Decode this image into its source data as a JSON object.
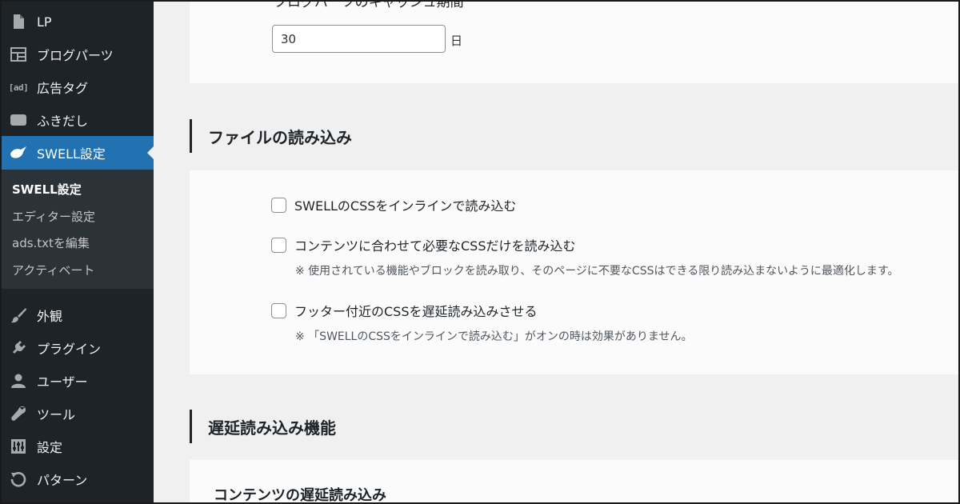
{
  "sidebar": {
    "items": [
      {
        "label": "LP",
        "icon": "page-icon"
      },
      {
        "label": "ブログパーツ",
        "icon": "layout-icon"
      },
      {
        "label": "広告タグ",
        "icon": "ad-icon",
        "icon_text": "[ad]"
      },
      {
        "label": "ふきだし",
        "icon": "speech-bubble-icon"
      },
      {
        "label": "SWELL設定",
        "icon": "swell-bird-icon",
        "active": true
      },
      {
        "label": "外観",
        "icon": "paintbrush-icon"
      },
      {
        "label": "プラグイン",
        "icon": "plug-icon"
      },
      {
        "label": "ユーザー",
        "icon": "user-icon"
      },
      {
        "label": "ツール",
        "icon": "wrench-icon"
      },
      {
        "label": "設定",
        "icon": "sliders-icon"
      },
      {
        "label": "パターン",
        "icon": "undo-icon"
      }
    ],
    "submenu": [
      {
        "label": "SWELL設定",
        "current": true
      },
      {
        "label": "エディター設定"
      },
      {
        "label": "ads.txtを編集"
      },
      {
        "label": "アクティベート"
      }
    ],
    "colors": {
      "background": "#1d2327",
      "active": "#2271b1",
      "submenu": "#2c3338"
    }
  },
  "cache": {
    "label": "ブログパーツのキャッシュ期間",
    "value": "30",
    "unit": "日"
  },
  "file_loading": {
    "title": "ファイルの読み込み",
    "options": [
      {
        "label": "SWELLのCSSをインラインで読み込む",
        "checked": false
      },
      {
        "label": "コンテンツに合わせて必要なCSSだけを読み込む",
        "checked": false,
        "note": "※ 使用されている機能やブロックを読み取り、そのページに不要なCSSはできる限り読み込まないように最適化します。"
      },
      {
        "label": "フッター付近のCSSを遅延読み込みさせる",
        "checked": false,
        "note": "※ 「SWELLのCSSをインラインで読み込む」がオンの時は効果がありません。"
      }
    ]
  },
  "lazy_loading": {
    "title": "遅延読み込み機能",
    "subtitle": "コンテンツの遅延読み込み"
  }
}
